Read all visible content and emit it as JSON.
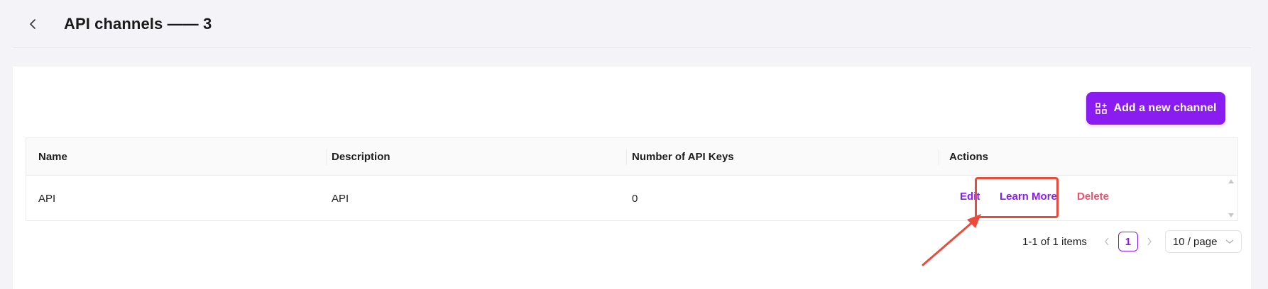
{
  "header": {
    "title": "API channels —— 3"
  },
  "toolbar": {
    "add_label": "Add a new channel"
  },
  "table": {
    "columns": [
      "Name",
      "Description",
      "Number of API Keys",
      "Actions"
    ],
    "rows": [
      {
        "name": "API",
        "description": "API",
        "api_keys": "0"
      }
    ],
    "actions": {
      "edit": "Edit",
      "learn_more": "Learn More",
      "delete": "Delete"
    }
  },
  "pagination": {
    "total_text": "1-1 of 1 items",
    "current_page": "1",
    "page_size": "10 / page"
  },
  "colors": {
    "accent": "#8a1cf2",
    "danger": "#f0506e",
    "annotation": "#ea4b3c"
  }
}
